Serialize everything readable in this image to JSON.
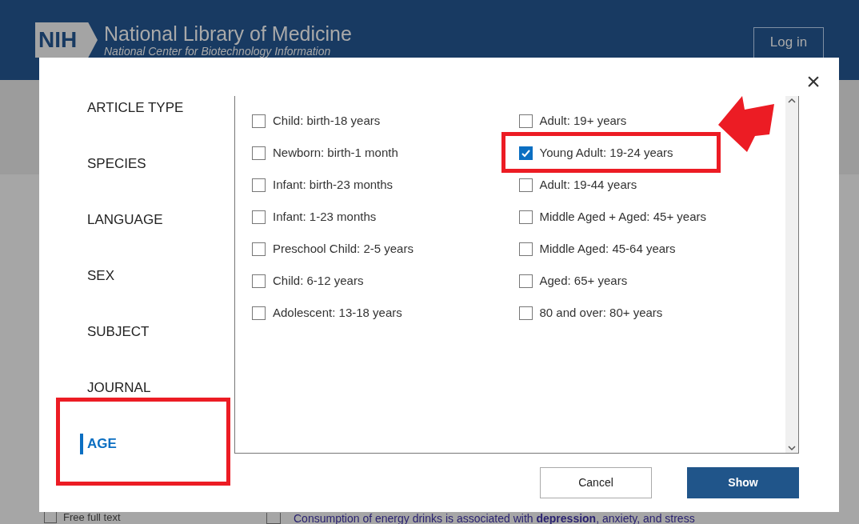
{
  "header": {
    "logo": "NIH",
    "title": "National Library of Medicine",
    "subtitle": "National Center for Biotechnology Information",
    "login": "Log in"
  },
  "background": {
    "filter": "Free full text",
    "filter_checked": false,
    "result_checked": false,
    "result": "Consumption of energy drinks is associated with **depression**, anxiety, and stress"
  },
  "dialog": {
    "close": "×",
    "nav": [
      {
        "label": "ARTICLE TYPE",
        "selected": false,
        "highlighted": false
      },
      {
        "label": "SPECIES",
        "selected": false,
        "highlighted": false
      },
      {
        "label": "LANGUAGE",
        "selected": false,
        "highlighted": false
      },
      {
        "label": "SEX",
        "selected": false,
        "highlighted": false
      },
      {
        "label": "SUBJECT",
        "selected": false,
        "highlighted": false
      },
      {
        "label": "JOURNAL",
        "selected": false,
        "highlighted": false
      },
      {
        "label": "AGE",
        "selected": true,
        "highlighted": true
      }
    ],
    "options": [
      {
        "label": "Child: birth-18 years",
        "checked": false,
        "highlighted": false,
        "arrow": false
      },
      {
        "label": "Adult: 19+ years",
        "checked": false,
        "highlighted": false,
        "arrow": false
      },
      {
        "label": "Newborn: birth-1 month",
        "checked": false,
        "highlighted": false,
        "arrow": false
      },
      {
        "label": "Young Adult: 19-24 years",
        "checked": true,
        "highlighted": true,
        "arrow": true
      },
      {
        "label": "Infant: birth-23 months",
        "checked": false,
        "highlighted": false,
        "arrow": false
      },
      {
        "label": "Adult: 19-44 years",
        "checked": false,
        "highlighted": false,
        "arrow": false
      },
      {
        "label": "Infant: 1-23 months",
        "checked": false,
        "highlighted": false,
        "arrow": false
      },
      {
        "label": "Middle Aged + Aged: 45+ years",
        "checked": false,
        "highlighted": false,
        "arrow": false
      },
      {
        "label": "Preschool Child: 2-5 years",
        "checked": false,
        "highlighted": false,
        "arrow": false
      },
      {
        "label": "Middle Aged: 45-64 years",
        "checked": false,
        "highlighted": false,
        "arrow": false
      },
      {
        "label": "Child: 6-12 years",
        "checked": false,
        "highlighted": false,
        "arrow": false
      },
      {
        "label": "Aged: 65+ years",
        "checked": false,
        "highlighted": false,
        "arrow": false
      },
      {
        "label": "Adolescent: 13-18 years",
        "checked": false,
        "highlighted": false,
        "arrow": false
      },
      {
        "label": "80 and over: 80+ years",
        "checked": false,
        "highlighted": false,
        "arrow": false
      }
    ],
    "buttons": [
      {
        "label": "Cancel",
        "kind": "secondary"
      },
      {
        "label": "Show",
        "kind": "primary"
      }
    ]
  }
}
